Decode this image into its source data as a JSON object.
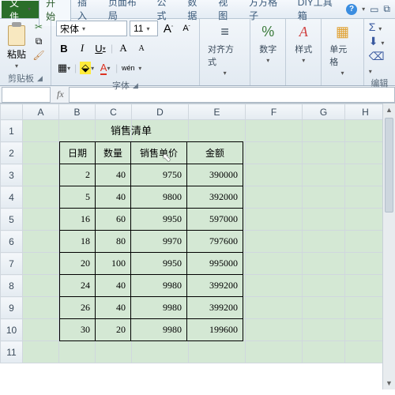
{
  "tabs": {
    "file": "文件",
    "items": [
      "开始",
      "插入",
      "页面布局",
      "公式",
      "数据",
      "视图",
      "方方格子",
      "DIY工具箱"
    ],
    "active_index": 0
  },
  "ribbon": {
    "clipboard": {
      "paste": "粘贴",
      "label": "剪贴板"
    },
    "font": {
      "name": "宋体",
      "size": "11",
      "bold": "B",
      "italic": "I",
      "underline": "U",
      "grow": "A",
      "shrink": "A",
      "wen": "wén",
      "label": "字体"
    },
    "align": {
      "label": "对齐方式"
    },
    "number": {
      "label": "数字",
      "icon": "%"
    },
    "styles": {
      "label": "样式",
      "icon": "A"
    },
    "cells": {
      "label": "单元格"
    },
    "editing": {
      "label": "编辑",
      "sigma": "Σ"
    }
  },
  "formula_bar": {
    "fx": "fx"
  },
  "columns": [
    "A",
    "B",
    "C",
    "D",
    "E",
    "F",
    "G",
    "H"
  ],
  "rows": [
    1,
    2,
    3,
    4,
    5,
    6,
    7,
    8,
    9,
    10,
    11
  ],
  "sales": {
    "title": "销售清单",
    "headers": [
      "日期",
      "数量",
      "销售单价",
      "金额"
    ],
    "rows": [
      [
        2,
        40,
        9750,
        390000
      ],
      [
        5,
        40,
        9800,
        392000
      ],
      [
        16,
        60,
        9950,
        597000
      ],
      [
        18,
        80,
        9970,
        797600
      ],
      [
        20,
        100,
        9950,
        995000
      ],
      [
        24,
        40,
        9980,
        399200
      ],
      [
        26,
        40,
        9980,
        399200
      ],
      [
        30,
        20,
        9980,
        199600
      ]
    ]
  },
  "chart_data": {
    "type": "table",
    "title": "销售清单",
    "columns": [
      "日期",
      "数量",
      "销售单价",
      "金额"
    ],
    "rows": [
      [
        2,
        40,
        9750,
        390000
      ],
      [
        5,
        40,
        9800,
        392000
      ],
      [
        16,
        60,
        9950,
        597000
      ],
      [
        18,
        80,
        9970,
        797600
      ],
      [
        20,
        100,
        9950,
        995000
      ],
      [
        24,
        40,
        9980,
        399200
      ],
      [
        26,
        40,
        9980,
        399200
      ],
      [
        30,
        20,
        9980,
        199600
      ]
    ]
  }
}
